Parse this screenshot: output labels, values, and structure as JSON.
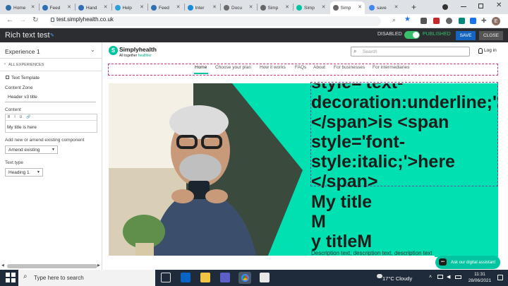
{
  "browser": {
    "tabs": [
      {
        "label": "Home",
        "color": "#2d6ea3",
        "active": false
      },
      {
        "label": "Feed",
        "color": "#2f6fb5",
        "active": false
      },
      {
        "label": "Hand",
        "color": "#2f6fb5",
        "active": false
      },
      {
        "label": "Help",
        "color": "#2aa0d8",
        "active": false
      },
      {
        "label": "Feed",
        "color": "#2f6fb5",
        "active": false
      },
      {
        "label": "Inter",
        "color": "#1a8ad4",
        "active": false
      },
      {
        "label": "Docu",
        "color": "#6b6b6b",
        "active": false
      },
      {
        "label": "Simp",
        "color": "#666666",
        "active": false
      },
      {
        "label": "Simp",
        "color": "#00c5a0",
        "active": false
      },
      {
        "label": "Simp",
        "color": "#666666",
        "active": true
      },
      {
        "label": "save",
        "color": "#4285f4",
        "active": false
      }
    ],
    "new_tab_symbol": "+",
    "url": "test.simplyhealth.co.uk",
    "profile_initial": "E"
  },
  "editor": {
    "title": "Rich text test",
    "disabled_label": "DISABLED",
    "published_label": "PUBLISHED",
    "save_label": "SAVE",
    "close_label": "CLOSE"
  },
  "panel": {
    "experience": "Experience 1",
    "all_experiences": "ALL EXPERIENCES",
    "template": "Text Template",
    "content_zone_label": "Content Zone",
    "content_zone_value": "Header v3 title",
    "content_label": "Content",
    "toolbar": [
      "B",
      "I",
      "U",
      "🔗"
    ],
    "content_value": "My title is here",
    "add_label": "Add new or amend existing component",
    "amend_value": "Amend existing",
    "text_type_label": "Text type",
    "text_type_value": "Heading 1"
  },
  "site": {
    "logo_text": "Simplyhealth",
    "tagline_a": "All together ",
    "tagline_b": "healthier",
    "search_placeholder": "Search",
    "login": "Log in",
    "nav": [
      "Home",
      "Choose your plan",
      "How it works",
      "FAQs",
      "About",
      "For businesses",
      "For intermediaries"
    ],
    "hero_code_lines": [
      "style='text-",
      "decoration:underline;'>",
      "</span>is <span",
      "style='font-",
      "style:italic;'>here",
      "</span>"
    ],
    "title_lines": [
      "My title",
      "M",
      "y titleM"
    ],
    "description": "Description text, description text, description text",
    "chat_label": "Ask our digital assistant"
  },
  "taskbar": {
    "search_placeholder": "Type here to search",
    "weather": "17°C  Cloudy",
    "time": "11:31",
    "date": "28/06/2021"
  }
}
